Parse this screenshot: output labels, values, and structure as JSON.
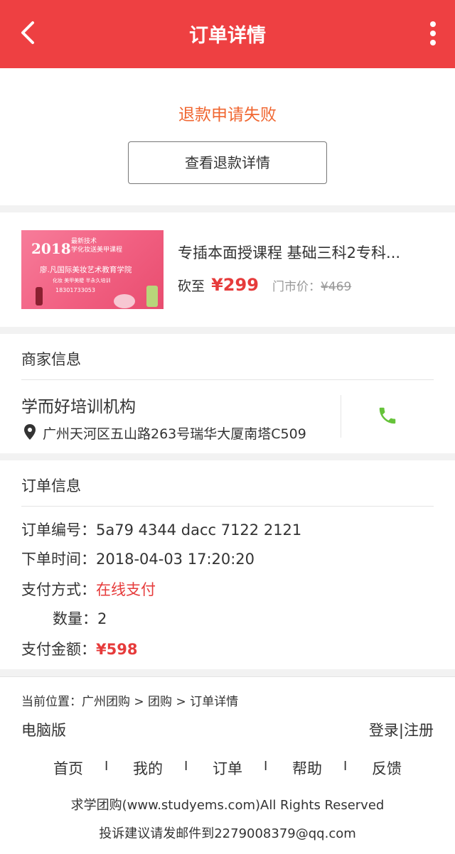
{
  "header": {
    "title": "订单详情",
    "back_icon": "chevron-left-icon",
    "more_icon": "more-vertical-icon",
    "color": "#ee4042"
  },
  "refund": {
    "status": "退款申请失败",
    "button": "查看退款详情",
    "status_color": "#f06630"
  },
  "product": {
    "image_text": {
      "year": "2018",
      "badge_line1": "最新技术",
      "badge_line2": "学化妆送美甲课程",
      "school": "廖.凡国际美妆艺术教育学院",
      "courses": "化妆 美甲美睫 半永久培训",
      "phone": "18301733053"
    },
    "name": "专插本面授课程 基础三科2专科...",
    "cut_label": "砍至",
    "price": "¥299",
    "market_label": "门市价：",
    "market_price": "¥469",
    "price_color": "#e63b3b"
  },
  "merchant": {
    "section_title": "商家信息",
    "name": "学而好培训机构",
    "address": "广州天河区五山路263号瑞华大厦南塔C509",
    "location_icon": "map-pin-icon",
    "phone_icon": "phone-icon",
    "phone_color": "#66c33a"
  },
  "order": {
    "section_title": "订单信息",
    "number_label": "订单编号：",
    "number": "5a79 4344 dacc 7122 2121",
    "time_label": "下单时间：",
    "time": "2018-04-03 17:20:20",
    "pay_method_label": "支付方式：",
    "pay_method": "在线支付",
    "qty_label": "数量：",
    "qty": "2",
    "amount_label": "支付金额：",
    "amount": "¥598"
  },
  "footer": {
    "breadcrumb": "当前位置：广州团购 > 团购 > 订单详情",
    "pc_version": "电脑版",
    "login": "登录",
    "login_sep": "|",
    "register": "注册",
    "nav": [
      "首页",
      "我的",
      "订单",
      "帮助",
      "反馈"
    ],
    "nav_sep": "I",
    "copyright": "求学团购(www.studyems.com)All Rights Reserved",
    "complaint": "投诉建议请发邮件到2279008379@qq.com"
  }
}
